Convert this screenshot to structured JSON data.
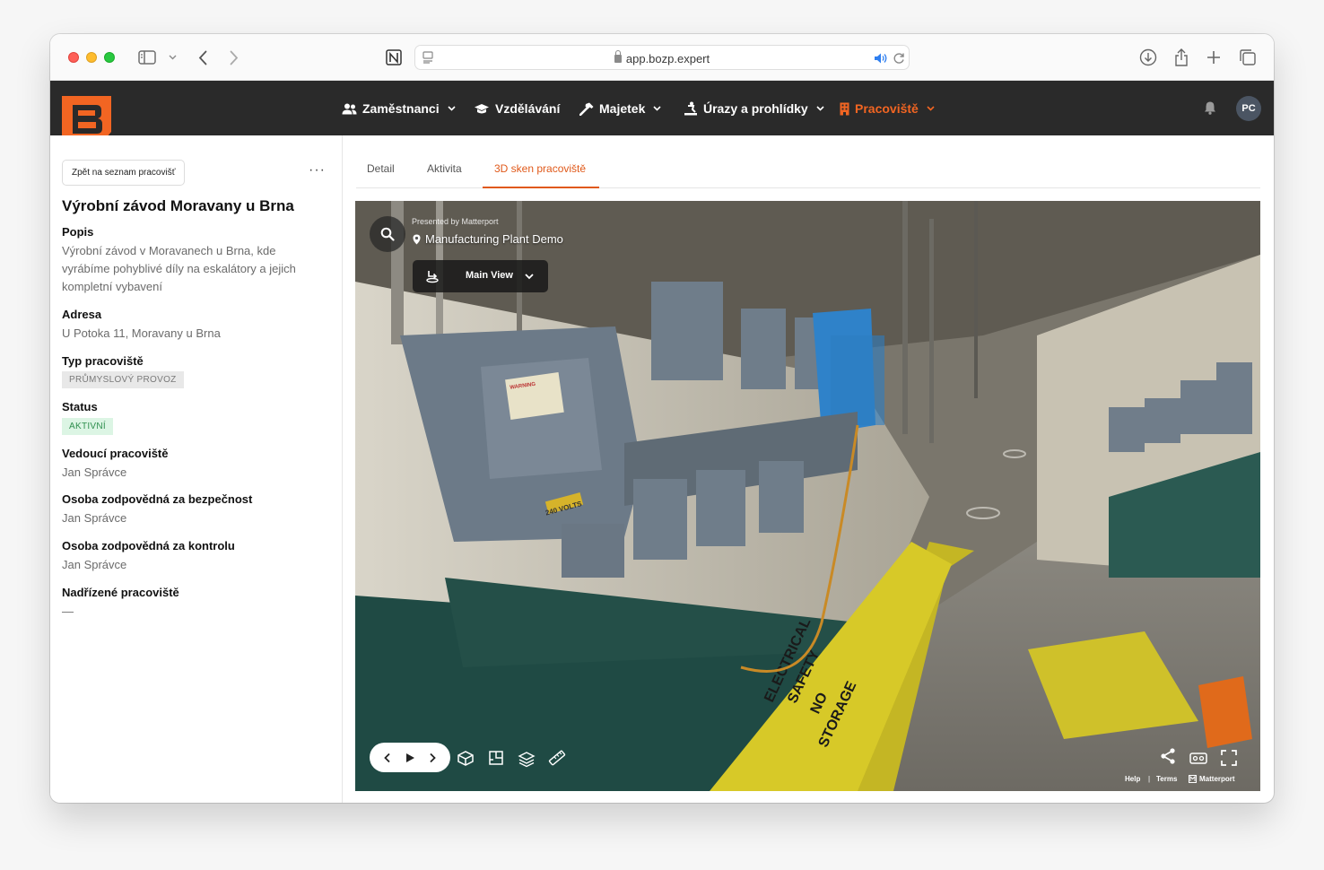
{
  "browser": {
    "url": "app.bozp.expert"
  },
  "nav": {
    "items": [
      {
        "label": "Zaměstnanci",
        "icon": "users-icon",
        "has_dropdown": true
      },
      {
        "label": "Vzdělávání",
        "icon": "graduation-cap-icon",
        "has_dropdown": false
      },
      {
        "label": "Majetek",
        "icon": "hammer-icon",
        "has_dropdown": true
      },
      {
        "label": "Úrazy a prohlídky",
        "icon": "injury-icon",
        "has_dropdown": true
      },
      {
        "label": "Pracoviště",
        "icon": "building-icon",
        "has_dropdown": true,
        "active": true
      }
    ],
    "avatar_initials": "PC",
    "accent_color": "#f26522"
  },
  "sidebar": {
    "back_label": "Zpět na seznam pracovišť",
    "more_label": "···",
    "title": "Výrobní závod Moravany u Brna",
    "fields": {
      "popis_label": "Popis",
      "popis_value": "Výrobní závod v Moravanech u Brna, kde vyrábíme pohyblivé díly na eskalátory a jejich kompletní vybavení",
      "adresa_label": "Adresa",
      "adresa_value": "U Potoka 11, Moravany u Brna",
      "typ_label": "Typ pracoviště",
      "typ_value": "PRŮMYSLOVÝ PROVOZ",
      "status_label": "Status",
      "status_value": "AKTIVNÍ",
      "vedouci_label": "Vedoucí pracoviště",
      "vedouci_value": "Jan Správce",
      "bezpecnost_label": "Osoba zodpovědná za bezpečnost",
      "bezpecnost_value": "Jan Správce",
      "kontrola_label": "Osoba zodpovědná za kontrolu",
      "kontrola_value": "Jan Správce",
      "nadrizene_label": "Nadřízené pracoviště",
      "nadrizene_value": "—"
    }
  },
  "tabs": [
    {
      "label": "Detail"
    },
    {
      "label": "Aktivita"
    },
    {
      "label": "3D sken pracoviště",
      "active": true
    }
  ],
  "viewer": {
    "presented_by": "Presented by Matterport",
    "model_name": "Manufacturing Plant Demo",
    "view_label": "Main View",
    "footer_help": "Help",
    "footer_sep": "|",
    "footer_terms": "Terms",
    "footer_brand": "Matterport",
    "floor_text_1": "ELECTRICAL",
    "floor_text_2": "SAFETY",
    "floor_text_3": "NO",
    "floor_text_4": "STORAGE",
    "label_240": "240 VOLTS",
    "label_warning": "WARNING"
  }
}
